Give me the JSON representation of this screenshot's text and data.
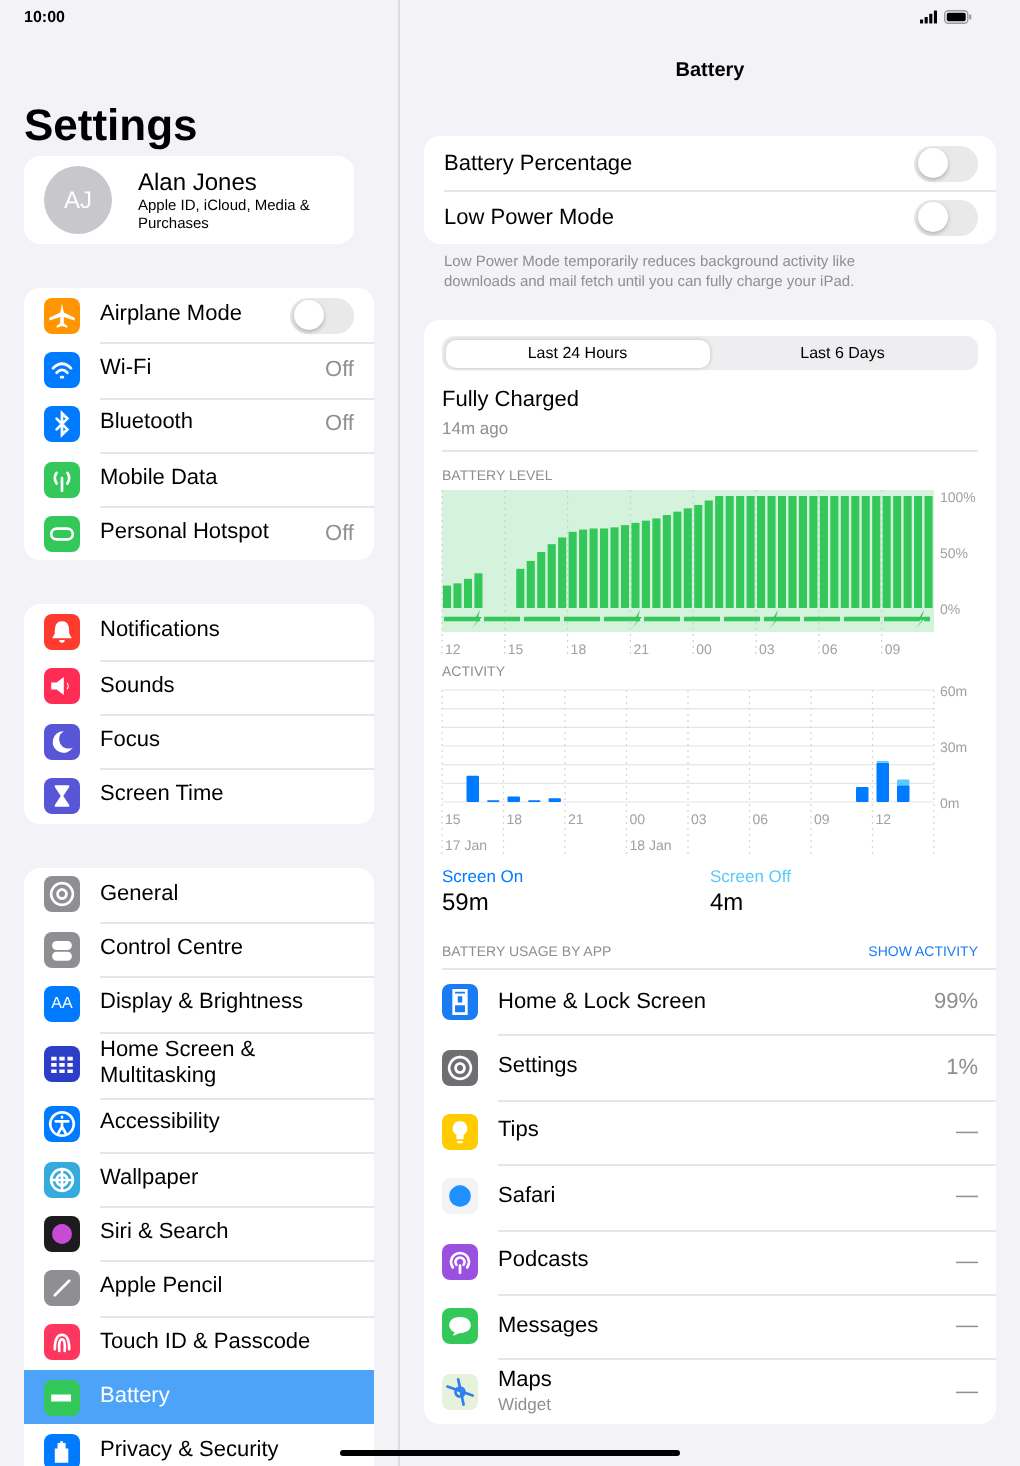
{
  "status_bar": {
    "time": "10:00"
  },
  "sidebar": {
    "title": "Settings",
    "profile": {
      "initials": "AJ",
      "name": "Alan Jones",
      "subtitle": "Apple ID, iCloud, Media & Purchases"
    },
    "groups": [
      [
        {
          "label": "Airplane Mode",
          "kind": "toggle",
          "on": false,
          "selected": false
        },
        {
          "label": "Wi-Fi",
          "kind": "value",
          "value": "Off",
          "selected": false
        },
        {
          "label": "Bluetooth",
          "kind": "value",
          "value": "Off",
          "selected": false
        },
        {
          "label": "Mobile Data",
          "kind": "plain",
          "selected": false
        },
        {
          "label": "Personal Hotspot",
          "kind": "value",
          "value": "Off",
          "selected": false
        }
      ],
      [
        {
          "label": "Notifications",
          "kind": "plain",
          "selected": false
        },
        {
          "label": "Sounds",
          "kind": "plain",
          "selected": false
        },
        {
          "label": "Focus",
          "kind": "plain",
          "selected": false
        },
        {
          "label": "Screen Time",
          "kind": "plain",
          "selected": false
        }
      ],
      [
        {
          "label": "General",
          "kind": "plain",
          "selected": false
        },
        {
          "label": "Control Centre",
          "kind": "plain",
          "selected": false
        },
        {
          "label": "Display & Brightness",
          "kind": "plain",
          "icon_label": "AA",
          "selected": false
        },
        {
          "label": "Home Screen & Multitasking",
          "kind": "plain",
          "selected": false
        },
        {
          "label": "Accessibility",
          "kind": "plain",
          "selected": false
        },
        {
          "label": "Wallpaper",
          "kind": "plain",
          "selected": false
        },
        {
          "label": "Siri & Search",
          "kind": "plain",
          "selected": false
        },
        {
          "label": "Apple Pencil",
          "kind": "plain",
          "selected": false
        },
        {
          "label": "Touch ID & Passcode",
          "kind": "plain",
          "selected": false
        },
        {
          "label": "Battery",
          "kind": "plain",
          "selected": true
        },
        {
          "label": "Privacy & Security",
          "kind": "plain",
          "selected": false
        }
      ]
    ]
  },
  "detail": {
    "title": "Battery",
    "switches": [
      {
        "label": "Battery Percentage",
        "on": false
      },
      {
        "label": "Low Power Mode",
        "on": false
      }
    ],
    "footnote": "Low Power Mode temporarily reduces background activity like downloads and mail fetch until you can fully charge your iPad.",
    "tabs": [
      {
        "label": "Last 24 Hours",
        "selected": true
      },
      {
        "label": "Last 6 Days",
        "selected": false
      }
    ],
    "last_charge": {
      "title": "Fully Charged",
      "time": "14m ago"
    },
    "battery_level": {
      "heading": "BATTERY LEVEL",
      "chart_data": {
        "type": "bar",
        "ylim": [
          0,
          100
        ],
        "yticks": [
          {
            "value": 0,
            "label": "0%"
          },
          {
            "value": 50,
            "label": "50%"
          },
          {
            "value": 100,
            "label": "100%"
          }
        ],
        "categories": [
          "12",
          null,
          null,
          null,
          null,
          null,
          "15",
          null,
          null,
          null,
          null,
          null,
          "18",
          null,
          null,
          null,
          null,
          null,
          "21",
          null,
          null,
          null,
          null,
          null,
          "00",
          null,
          null,
          null,
          null,
          null,
          "03",
          null,
          null,
          null,
          null,
          null,
          "06",
          null,
          null,
          null,
          null,
          null,
          "09",
          null,
          null,
          null,
          null
        ],
        "series": [
          {
            "color": "#34c759",
            "values": [
              20,
              22,
              26,
              31,
              null,
              null,
              null,
              35,
              42,
              50,
              57,
              63,
              68,
              70,
              71,
              71,
              72,
              74,
              76,
              78,
              80,
              83,
              86,
              89,
              92,
              96,
              100,
              100,
              100,
              100,
              100,
              100,
              100,
              100,
              100,
              100,
              100,
              100,
              100,
              100,
              100,
              100,
              100,
              100,
              100,
              100,
              100
            ]
          }
        ]
      }
    },
    "activity": {
      "heading": "ACTIVITY",
      "chart_data": {
        "type": "bar",
        "stacked": true,
        "ylim": [
          0,
          60
        ],
        "yticks": [
          {
            "value": 0,
            "label": "0m"
          },
          {
            "value": 30,
            "label": "30m"
          },
          {
            "value": 60,
            "label": "60m"
          }
        ],
        "categories": [
          "15",
          null,
          null,
          "18",
          null,
          null,
          "21",
          null,
          null,
          "00",
          null,
          null,
          "03",
          null,
          null,
          "06",
          null,
          null,
          "09",
          null,
          null,
          "12",
          null,
          null
        ],
        "series": [
          {
            "name": "Screen On",
            "color": "#007aff",
            "values": [
              0,
              14,
              1,
              3,
              1,
              2,
              0,
              0,
              0,
              0,
              0,
              0,
              0,
              0,
              0,
              0,
              0,
              0,
              0,
              0,
              8,
              21,
              9,
              0
            ]
          },
          {
            "name": "Screen Off",
            "color": "#5ac8fa",
            "values": [
              0,
              0,
              0,
              0,
              0,
              0,
              0,
              0,
              0,
              0,
              0,
              0,
              0,
              0,
              0,
              0,
              0,
              0,
              0,
              0,
              0,
              1,
              3,
              0
            ]
          }
        ]
      },
      "date_labels": [
        "17 Jan",
        "18 Jan"
      ]
    },
    "screen_stats": [
      {
        "value": "59m"
      },
      {
        "value": "4m"
      }
    ],
    "usage": {
      "heading": "BATTERY USAGE BY APP",
      "action": "SHOW ACTIVITY",
      "apps": [
        {
          "name": "Home & Lock Screen",
          "value": "99%"
        },
        {
          "name": "Settings",
          "value": "1%"
        },
        {
          "name": "Tips",
          "value": "—"
        },
        {
          "name": "Safari",
          "value": "—"
        },
        {
          "name": "Podcasts",
          "value": "—"
        },
        {
          "name": "Messages",
          "value": "—"
        },
        {
          "name": "Maps",
          "subtitle": "Widget",
          "value": "—"
        }
      ]
    }
  }
}
